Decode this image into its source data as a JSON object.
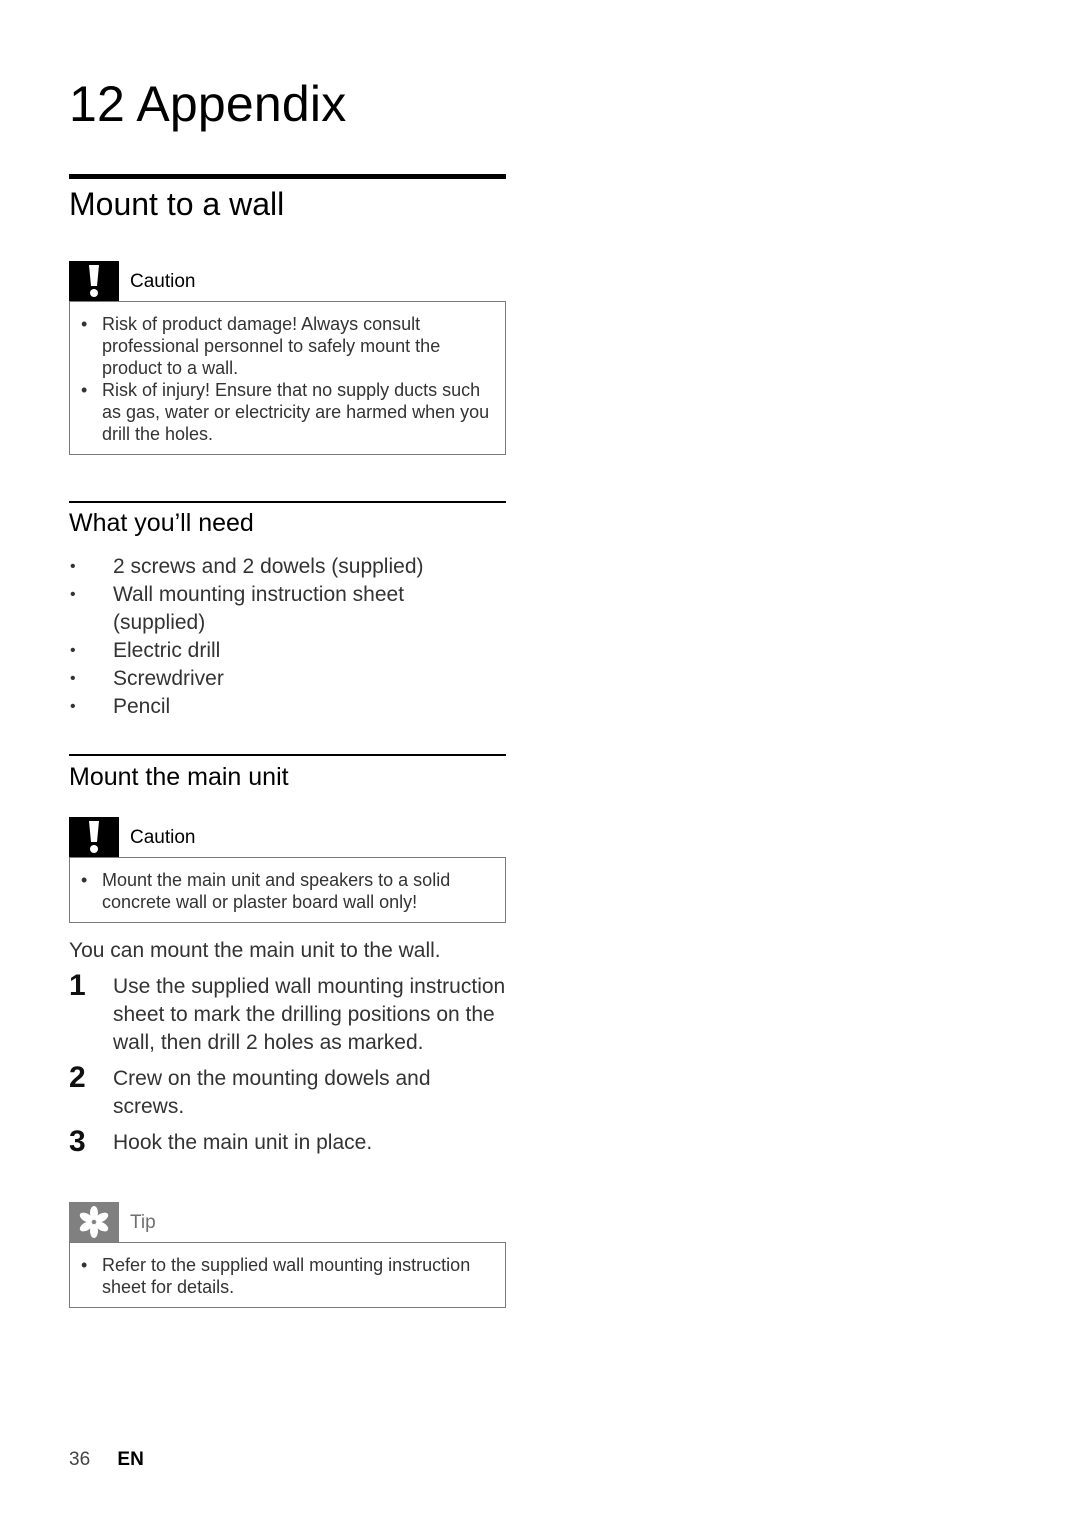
{
  "chapter": {
    "title": "12 Appendix"
  },
  "section": {
    "title": "Mount to a wall"
  },
  "caution1": {
    "label": "Caution",
    "icon": "exclamation-icon",
    "items": [
      "Risk of product damage! Always consult professional personnel to safely mount the product to a wall.",
      "Risk of injury! Ensure that no supply ducts such as gas, water or electricity are harmed when you drill the holes."
    ]
  },
  "needs": {
    "title": "What you’ll need",
    "items": [
      "2 screws and 2 dowels (supplied)",
      "Wall mounting instruction sheet (supplied)",
      "Electric drill",
      "Screwdriver",
      "Pencil"
    ]
  },
  "mount_main": {
    "title": "Mount the main unit",
    "caution": {
      "label": "Caution",
      "icon": "exclamation-icon",
      "items": [
        "Mount the main unit and speakers to a solid concrete wall or plaster board wall only!"
      ]
    },
    "intro": "You can mount the main unit to the wall.",
    "steps": [
      {
        "num": "1",
        "text": "Use the supplied wall mounting instruction sheet to mark the drilling positions on the wall, then drill 2 holes as marked."
      },
      {
        "num": "2",
        "text": "Crew on the mounting dowels and screws."
      },
      {
        "num": "3",
        "text": "Hook the main unit in place."
      }
    ],
    "tip": {
      "label": "Tip",
      "icon": "asterisk-icon",
      "items": [
        "Refer to the supplied wall mounting instruction sheet for details."
      ]
    }
  },
  "footer": {
    "page_number": "36",
    "language": "EN"
  },
  "bullet": "•"
}
